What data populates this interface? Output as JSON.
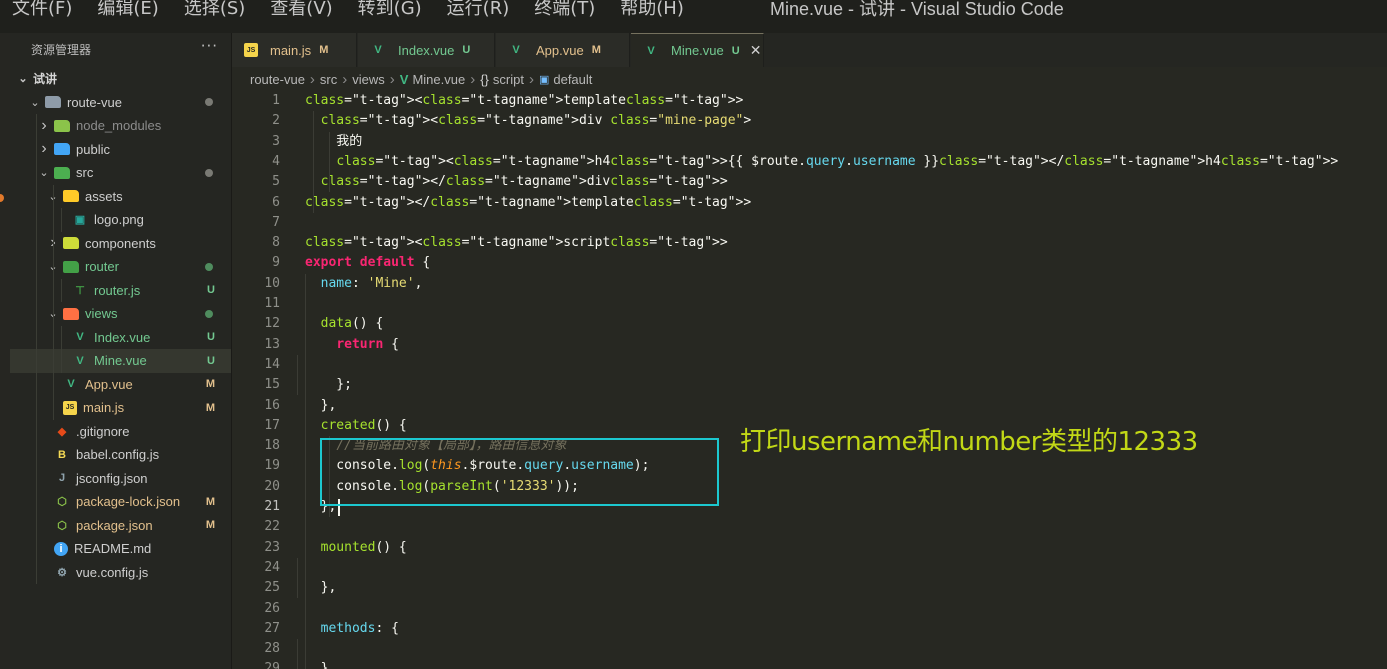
{
  "menu": [
    "文件(F)",
    "编辑(E)",
    "选择(S)",
    "查看(V)",
    "转到(G)",
    "运行(R)",
    "终端(T)",
    "帮助(H)"
  ],
  "window_title": "Mine.vue - 试讲 - Visual Studio Code",
  "sidebar": {
    "title": "资源管理器",
    "more": "···",
    "workspace": "试讲"
  },
  "tree": [
    {
      "label": "route-vue",
      "depth": 1,
      "chev": "down",
      "icon": "folder-open-icon",
      "status": "dot-gray"
    },
    {
      "label": "node_modules",
      "depth": 2,
      "chev": "right",
      "icon": "node-folder-icon",
      "dim": true
    },
    {
      "label": "public",
      "depth": 2,
      "chev": "right",
      "icon": "public-folder-icon"
    },
    {
      "label": "src",
      "depth": 2,
      "chev": "down",
      "icon": "src-folder-icon",
      "status": "dot-gray"
    },
    {
      "label": "assets",
      "depth": 3,
      "chev": "down",
      "icon": "assets-folder-icon"
    },
    {
      "label": "logo.png",
      "depth": 4,
      "chev": "none",
      "icon": "image-file-icon"
    },
    {
      "label": "components",
      "depth": 3,
      "chev": "right",
      "icon": "components-folder-icon"
    },
    {
      "label": "router",
      "depth": 3,
      "chev": "down",
      "icon": "router-folder-icon",
      "color": "untracked",
      "status": "dot-green"
    },
    {
      "label": "router.js",
      "depth": 4,
      "chev": "none",
      "icon": "router-file-icon",
      "color": "untracked",
      "status": "U"
    },
    {
      "label": "views",
      "depth": 3,
      "chev": "down",
      "icon": "views-folder-icon",
      "color": "untracked",
      "status": "dot-green"
    },
    {
      "label": "Index.vue",
      "depth": 4,
      "chev": "none",
      "icon": "vue-file-icon",
      "color": "untracked",
      "status": "U"
    },
    {
      "label": "Mine.vue",
      "depth": 4,
      "chev": "none",
      "icon": "vue-file-icon",
      "color": "untracked",
      "status": "U",
      "selected": true
    },
    {
      "label": "App.vue",
      "depth": 3,
      "chev": "none",
      "icon": "vue-file-icon",
      "color": "mod",
      "status": "M"
    },
    {
      "label": "main.js",
      "depth": 3,
      "chev": "none",
      "icon": "js-file-icon",
      "color": "mod",
      "status": "M"
    },
    {
      "label": ".gitignore",
      "depth": 2,
      "chev": "none",
      "icon": "git-file-icon"
    },
    {
      "label": "babel.config.js",
      "depth": 2,
      "chev": "none",
      "icon": "babel-file-icon"
    },
    {
      "label": "jsconfig.json",
      "depth": 2,
      "chev": "none",
      "icon": "json-file-icon"
    },
    {
      "label": "package-lock.json",
      "depth": 2,
      "chev": "none",
      "icon": "node-file-icon",
      "color": "mod",
      "status": "M"
    },
    {
      "label": "package.json",
      "depth": 2,
      "chev": "none",
      "icon": "node-file-icon",
      "color": "mod",
      "status": "M"
    },
    {
      "label": "README.md",
      "depth": 2,
      "chev": "none",
      "icon": "info-file-icon"
    },
    {
      "label": "vue.config.js",
      "depth": 2,
      "chev": "none",
      "icon": "vue-config-file-icon"
    }
  ],
  "tabs": [
    {
      "label": "main.js",
      "badge": "M",
      "icon": "js-file-icon",
      "color": "mod"
    },
    {
      "label": "Index.vue",
      "badge": "U",
      "icon": "vue-file-icon",
      "color": "untracked"
    },
    {
      "label": "App.vue",
      "badge": "M",
      "icon": "vue-file-icon",
      "color": "mod"
    },
    {
      "label": "Mine.vue",
      "badge": "U",
      "icon": "vue-file-icon",
      "color": "untracked",
      "active": true,
      "close": "✕"
    }
  ],
  "breadcrumb": [
    "route-vue",
    "src",
    "views",
    "Mine.vue",
    "script",
    "default"
  ],
  "code_lines": [
    "<template>",
    "  <div class=\"mine-page\">",
    "    我的",
    "    <h4>{{ $route.query.username }}</h4>",
    "  </div>",
    "</template>",
    "",
    "<script>",
    "export default {",
    "  name: 'Mine',",
    "",
    "  data() {",
    "    return {",
    "",
    "    };",
    "  },",
    "  created() {",
    "    //当前路由对象【局部】，路由信息对象",
    "    console.log(this.$route.query.username);",
    "    console.log(parseInt('12333'));",
    "  },",
    "",
    "  mounted() {",
    "",
    "  },",
    "",
    "  methods: {",
    "",
    "  }"
  ],
  "line_numbers": [
    "1",
    "2",
    "3",
    "4",
    "5",
    "6",
    "7",
    "8",
    "9",
    "10",
    "11",
    "12",
    "13",
    "14",
    "15",
    "16",
    "17",
    "18",
    "19",
    "20",
    "21",
    "22",
    "23",
    "24",
    "25",
    "26",
    "27",
    "28",
    "29"
  ],
  "active_line": "21",
  "annotation": "打印username和number类型的12333",
  "colors": {
    "modified": "#e2c08d",
    "untracked": "#73c991",
    "annotation_box": "#1cc8cf",
    "annotation_text": "#c2d816"
  }
}
